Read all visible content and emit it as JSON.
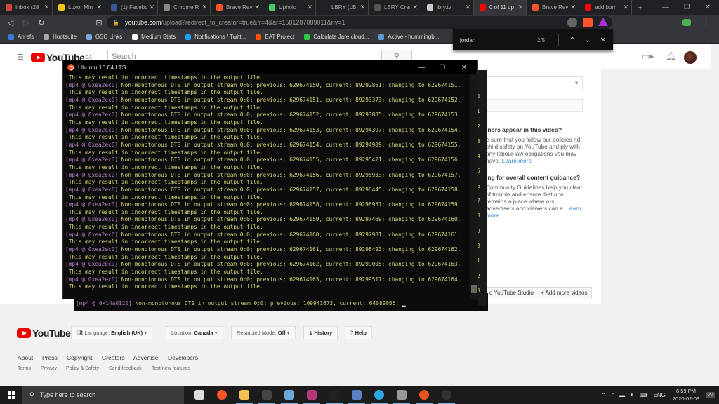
{
  "browser": {
    "tabs": [
      {
        "title": "Inbox (28",
        "favicon": "gmail-icon",
        "color": "#d44638",
        "active": false
      },
      {
        "title": "Luxor Min",
        "favicon": "luxor-icon",
        "color": "#f5c518",
        "active": false
      },
      {
        "title": "(1) Facebo",
        "favicon": "facebook-icon",
        "color": "#3b5998",
        "active": false
      },
      {
        "title": "Chrome R",
        "favicon": "chrome-page-icon",
        "color": "#888888",
        "active": false
      },
      {
        "title": "Brave Rev",
        "favicon": "brave-icon",
        "color": "#fb542b",
        "active": false
      },
      {
        "title": "Uphold",
        "favicon": "uphold-icon",
        "color": "#49cc68",
        "active": false
      },
      {
        "title": "LBRY (LB",
        "favicon": "lbry-icon",
        "color": "#222222",
        "active": false
      },
      {
        "title": "LBRY Crea",
        "favicon": "lbry-creator-icon",
        "color": "#555555",
        "active": false
      },
      {
        "title": "lbry.tv",
        "favicon": "lbrytv-icon",
        "color": "#cccccc",
        "active": false
      },
      {
        "title": "0 of 11 up",
        "favicon": "youtube-icon",
        "color": "#ff0000",
        "active": true
      },
      {
        "title": "Brave Rev",
        "favicon": "brave-icon",
        "color": "#fb542b",
        "active": false
      },
      {
        "title": "add borr",
        "favicon": "youtube-icon",
        "color": "#ff0000",
        "active": false
      }
    ],
    "new_tab": "+",
    "window_controls": {
      "minimize": "—",
      "maximize": "❐",
      "close": "✕"
    },
    "url_host": "youtube.com",
    "url_path": "/upload?redirect_to_creator=true&fr=4&ar=1581287089011&nv=1",
    "bookmarks": [
      {
        "label": "Ahrefs",
        "icon": "ahrefs-icon",
        "color": "#3a7bd5"
      },
      {
        "label": "Hootsuite",
        "icon": "hootsuite-icon",
        "color": "#aaaaaa"
      },
      {
        "label": "GSC Links",
        "icon": "gsc-icon",
        "color": "#7aa7e0"
      },
      {
        "label": "Medium Stats",
        "icon": "medium-icon",
        "color": "#ffffff"
      },
      {
        "label": "Notifications / Twitt...",
        "icon": "twitter-icon",
        "color": "#1da1f2"
      },
      {
        "label": "BAT Project",
        "icon": "bat-icon",
        "color": "#ff5000"
      },
      {
        "label": "Calculate Jare.cloud...",
        "icon": "dollar-icon",
        "color": "#2ecc40"
      },
      {
        "label": "Active - hummingb...",
        "icon": "hummingbird-icon",
        "color": "#5a9bd5"
      }
    ],
    "find": {
      "query": "jordan",
      "count": "2/5",
      "prev": "⌃",
      "next": "⌄",
      "close": "✕"
    }
  },
  "youtube": {
    "logo_text": "YouTube",
    "logo_region": "CA",
    "search_placeholder": "Search",
    "select_caret": "▾",
    "minors_heading": "inors appear in this video?",
    "minors_text": "e sure that you follow our policies nd child safety on YouTube and ply with any labour law obligations you may have.",
    "learn_more": "Learn more",
    "guidance_heading": "ing for overall content guidance?",
    "guidance_text": "Community Guidelines help you clear of trouble and ensure that ube remains a place where ors, advertisers and viewers can e.",
    "studio_button": "o YouTube Studio",
    "add_more_button": "+ Add more videos",
    "footer": {
      "logo_text": "YouTube",
      "language_label": "Language:",
      "language_value": "English (UK)",
      "location_label": "Location:",
      "location_value": "Canada",
      "restricted_label": "Restricted Mode:",
      "restricted_value": "Off",
      "history": "History",
      "help": "Help",
      "links": [
        "About",
        "Press",
        "Copyright",
        "Creators",
        "Advertise",
        "Developers"
      ],
      "sublinks": [
        "Terms",
        "Privacy",
        "Policy & Safety",
        "Send feedback",
        "Test new features"
      ]
    }
  },
  "terminal": {
    "title": "Ubuntu 16.04 LTS",
    "prefix": "[mp4 @ 0xea2ec0]",
    "warning": " This may result in incorrect timestamps in the output file.",
    "entries": [
      {
        "previous": "629674150",
        "current": "89292861",
        "changing_to": "629674151"
      },
      {
        "previous": "629674151",
        "current": "89293373",
        "changing_to": "629674152"
      },
      {
        "previous": "629674152",
        "current": "89293885",
        "changing_to": "629674153"
      },
      {
        "previous": "629674153",
        "current": "89294397",
        "changing_to": "629674154"
      },
      {
        "previous": "629674154",
        "current": "89294909",
        "changing_to": "629674155"
      },
      {
        "previous": "629674155",
        "current": "89295421",
        "changing_to": "629674156"
      },
      {
        "previous": "629674156",
        "current": "89295933",
        "changing_to": "629674157"
      },
      {
        "previous": "629674157",
        "current": "89296445",
        "changing_to": "629674158"
      },
      {
        "previous": "629674158",
        "current": "89296957",
        "changing_to": "629674159"
      },
      {
        "previous": "629674159",
        "current": "89297469",
        "changing_to": "629674160"
      },
      {
        "previous": "629674160",
        "current": "89297981",
        "changing_to": "629674161"
      },
      {
        "previous": "629674161",
        "current": "89298493",
        "changing_to": "629674162"
      },
      {
        "previous": "629674162",
        "current": "89299005",
        "changing_to": "629674163"
      },
      {
        "previous": "629674163",
        "current": "89299517",
        "changing_to": "629674164"
      }
    ],
    "line_numbers": [
      "0",
      "1",
      "2",
      "3",
      "4",
      "5",
      "6",
      "7",
      "8",
      "9",
      "0",
      "1",
      "2",
      "3"
    ],
    "background_terminal": {
      "line1": ". This may result in incorrect timestamps in the output file.",
      "prefix": "[mp4 @ 0x14a0120]",
      "line2": " Non-monotonous DTS in output stream 0:0; previous: 109941673, current: 64089056;"
    }
  },
  "taskbar": {
    "search_placeholder": "Type here to search",
    "apps": [
      {
        "name": "task-view-icon",
        "color": "#dddddd",
        "open": false
      },
      {
        "name": "brave-icon",
        "color": "#fb542b",
        "open": false
      },
      {
        "name": "file-explorer-icon",
        "color": "#f2c14e",
        "open": true
      },
      {
        "name": "inkscape-icon",
        "color": "#444444",
        "open": true
      },
      {
        "name": "notepad-icon",
        "color": "#6aa8d8",
        "open": true
      },
      {
        "name": "winrar-icon",
        "color": "#b03a7a",
        "open": true
      },
      {
        "name": "cmd-icon",
        "color": "#222222",
        "open": true
      },
      {
        "name": "snip-icon",
        "color": "#5a7fc0",
        "open": true
      },
      {
        "name": "telegram-icon",
        "color": "#2ca5e0",
        "open": true
      },
      {
        "name": "calculator-icon",
        "color": "#999999",
        "open": true
      },
      {
        "name": "ubuntu-icon",
        "color": "#e95420",
        "open": true
      },
      {
        "name": "obs-icon",
        "color": "#333333",
        "open": true
      }
    ],
    "language": "ENG",
    "time": "6:59 PM",
    "date": "2020-02-09",
    "notifications": "27"
  }
}
